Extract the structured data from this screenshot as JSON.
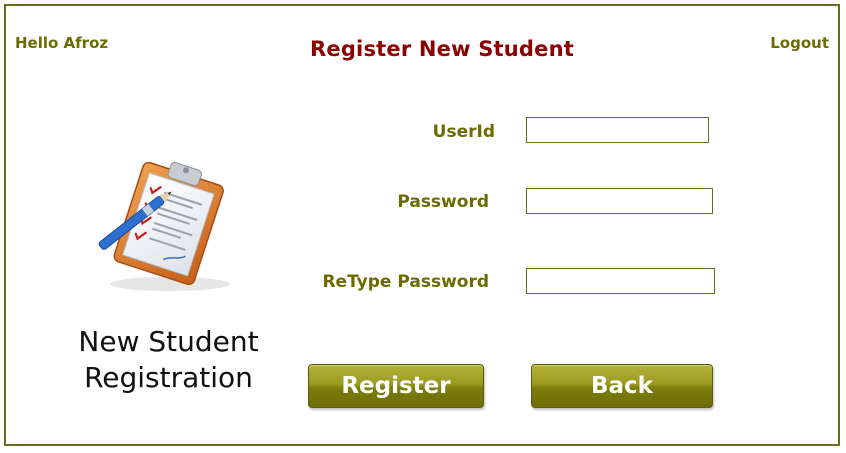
{
  "header": {
    "greeting": "Hello Afroz",
    "title": "Register New Student",
    "logout_label": "Logout"
  },
  "sidebar": {
    "image_icon": "clipboard-checklist-icon",
    "caption_line1": "New Student",
    "caption_line2": "Registration"
  },
  "form": {
    "userid_label": "UserId",
    "userid_value": "",
    "password_label": "Password",
    "password_value": "",
    "retype_label": "ReType Password",
    "retype_value": ""
  },
  "actions": {
    "register_label": "Register",
    "back_label": "Back"
  },
  "colors": {
    "label_color": "#6b6b00",
    "title_color": "#8b0000",
    "button_color": "#8a8a14",
    "border_color": "#6b6b1f"
  }
}
